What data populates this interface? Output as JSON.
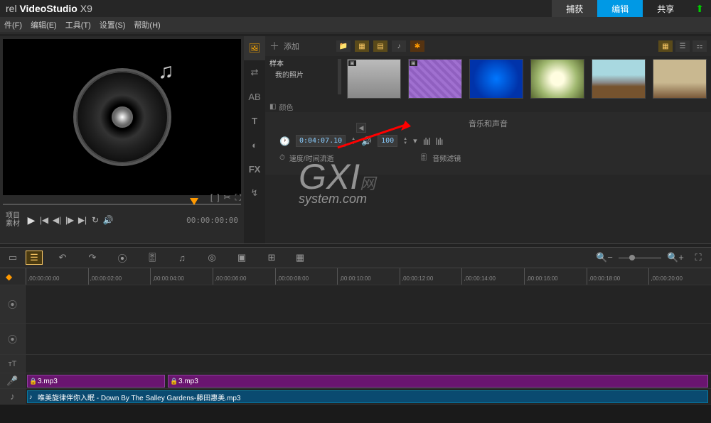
{
  "app": {
    "logo_prefix": "rel ",
    "logo_main": "VideoStudio",
    "logo_suffix": " X9"
  },
  "top_tabs": {
    "capture": "捕获",
    "edit": "编辑",
    "share": "共享"
  },
  "menu": {
    "file": "件(F)",
    "edit": "编辑(E)",
    "tools": "工具(T)",
    "settings": "设置(S)",
    "help": "帮助(H)"
  },
  "preview": {
    "mode_project": "项目",
    "mode_clip": "素材",
    "timecode": "00:00:00:00"
  },
  "library": {
    "add": "添加",
    "tree_root": "样本",
    "tree_child": "我的照片",
    "color_label": "颜色",
    "thumbs": [
      "",
      "",
      "",
      "",
      "",
      ""
    ]
  },
  "options": {
    "title": "音乐和声音",
    "duration": "0:04:07.10",
    "volume": "100",
    "speed_label": "速度/时间流逝",
    "filter_label": "音频滤镜"
  },
  "toolbar": {
    "zoom_out": "−",
    "zoom_in": "+"
  },
  "ruler": [
    ",00:00:00:00",
    ",00:00:02:00",
    ",00:00:04:00",
    ",00:00:06:00",
    ",00:00:08:00",
    ",00:00:10:00",
    ",00:00:12:00",
    ",00:00:14:00",
    ",00:00:16:00",
    ",00:00:18:00",
    ",00:00:20:00"
  ],
  "clips": {
    "audio1": "3.mp3",
    "audio2": "3.mp3",
    "music": "唯美旋律伴你入眠 - Down By The Salley Gardens-藤田惠美.mp3"
  },
  "watermark": {
    "main": "GXI",
    "sub": "网",
    "url": "system.com"
  }
}
